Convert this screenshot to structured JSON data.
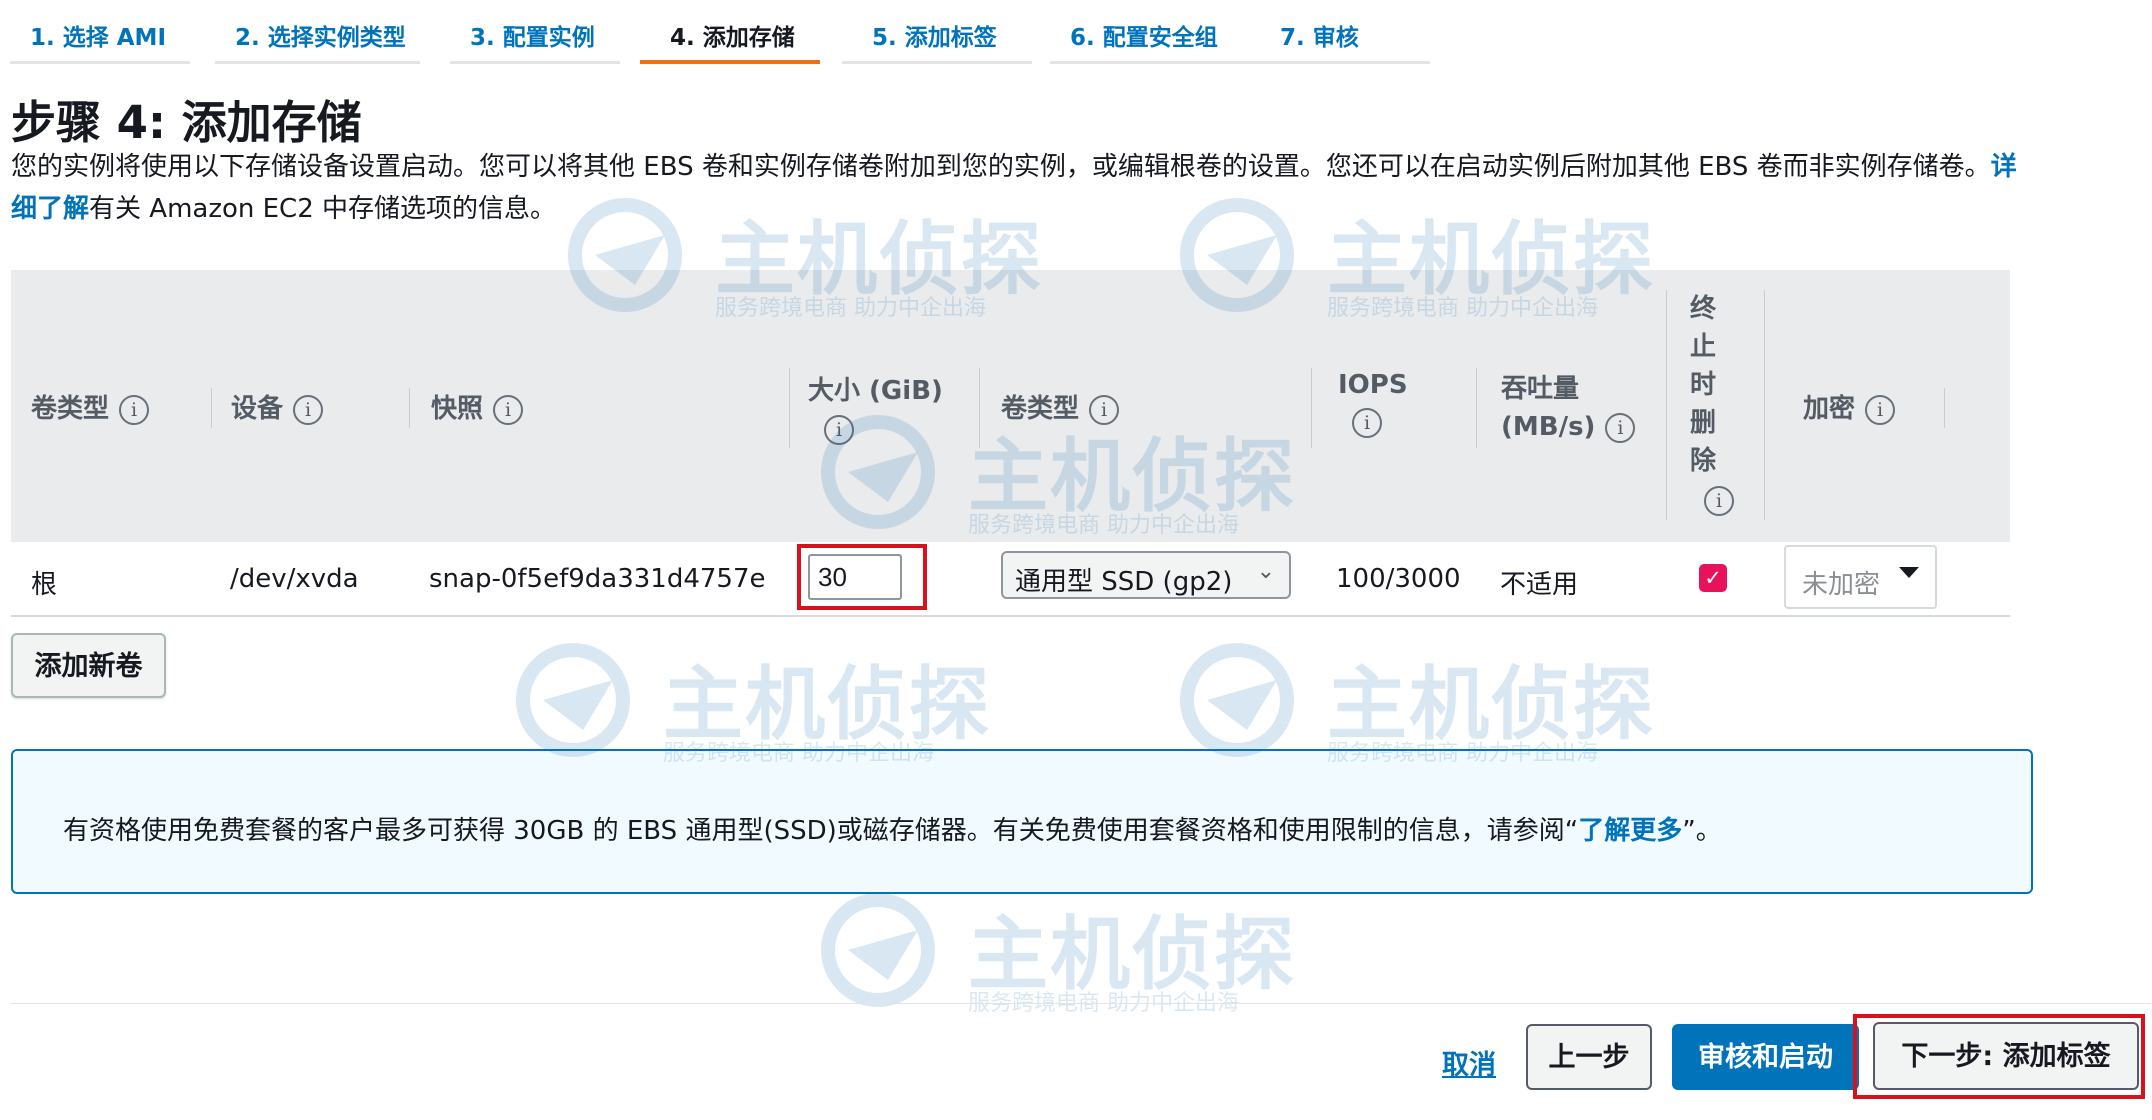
{
  "steps": [
    {
      "label": "1. 选择 AMI"
    },
    {
      "label": "2. 选择实例类型"
    },
    {
      "label": "3. 配置实例"
    },
    {
      "label": "4. 添加存储"
    },
    {
      "label": "5. 添加标签"
    },
    {
      "label": "6. 配置安全组"
    },
    {
      "label": "7. 审核"
    }
  ],
  "page": {
    "title": "步骤 4: 添加存储",
    "desc_text": "您的实例将使用以下存储设备设置启动。您可以将其他 EBS 卷和实例存储卷附加到您的实例，或编辑根卷的设置。您还可以在启动实例后附加其他 EBS 卷而非实例存储卷。",
    "desc_link": "详细了解",
    "desc_tail": "有关 Amazon EC2 中存储选项的信息。"
  },
  "table": {
    "headers": {
      "volume_type": "卷类型",
      "device": "设备",
      "snapshot": "快照",
      "size": "大小 (GiB)",
      "volume_kind": "卷类型",
      "iops": "IOPS",
      "throughput_1": "吞吐量",
      "throughput_2": "(MB/s)",
      "delete_1": "终",
      "delete_2": "止",
      "delete_3": "时",
      "delete_4": "删",
      "delete_5": "除",
      "encryption": "加密"
    },
    "info_glyph": "i",
    "row": {
      "volume_type": "根",
      "device": "/dev/xvda",
      "snapshot": "snap-0f5ef9da331d4757e",
      "size": "30",
      "volume_kind": "通用型 SSD (gp2)",
      "iops": "100/3000",
      "throughput": "不适用",
      "delete_on_termination": "✓",
      "encryption": "未加密"
    }
  },
  "buttons": {
    "add_volume": "添加新卷",
    "cancel": "取消",
    "previous": "上一步",
    "review_launch": "审核和启动",
    "next": "下一步: 添加标签"
  },
  "alert": {
    "text": "有资格使用免费套餐的客户最多可获得 30GB 的 EBS 通用型(SSD)或磁存储器。有关免费使用套餐资格和使用限制的信息，请参阅“",
    "link": "了解更多",
    "tail": "”。"
  },
  "watermark": {
    "main": "主机侦探",
    "sub": "服务跨境电商 助力中企出海"
  },
  "colors": {
    "accent": "#0073bb",
    "active_tab": "#ec7211",
    "highlight": "#d9111c",
    "checkbox": "#e8115b"
  }
}
